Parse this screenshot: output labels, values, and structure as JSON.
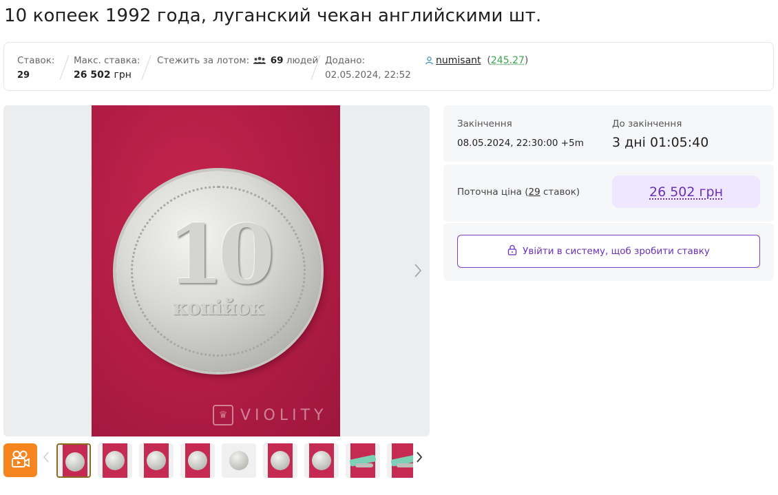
{
  "title": "10 копеек 1992 года, луганский чекан английскими шт.",
  "stats": {
    "bids_label": "Ставок:",
    "bids_value": "29",
    "max_bid_label": "Макс. ставка:",
    "max_bid_value": "26 502",
    "max_bid_unit": "грн",
    "watch_label": "Стежить за лотом:",
    "watch_count": "69",
    "watch_suffix": "людей",
    "added_label": "Додано:",
    "added_value": "02.05.2024, 22:52",
    "seller_name": "numisant",
    "seller_rating": "245.27"
  },
  "gallery": {
    "coin_number": "10",
    "coin_word": "копійок",
    "watermark": "VIOLITY",
    "thumbnail_count": 9
  },
  "auction": {
    "end_label": "Закінчення",
    "end_value": "08.05.2024, 22:30:00 +5m",
    "remaining_label": "До закінчення",
    "remaining_value": "3 дні 01:05:40",
    "current_price_label": "Поточна ціна (",
    "current_price_count": "29",
    "current_price_suffix": " ставок)",
    "current_price_value": "26 502 грн",
    "login_button": "Увійти в систему, щоб зробити ставку"
  },
  "colors": {
    "accent": "#6a2fb8",
    "video_button": "#f7851f",
    "rating": "#3aa64a"
  }
}
